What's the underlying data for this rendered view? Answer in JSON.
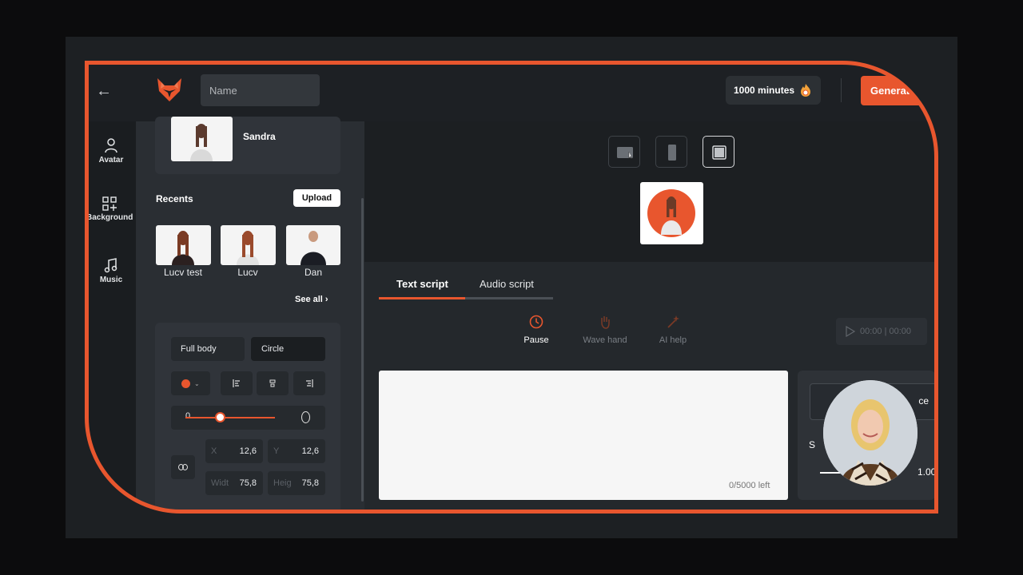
{
  "header": {
    "name_placeholder": "Name",
    "minutes_label": "1000 minutes",
    "generate_label": "Generate"
  },
  "rail": {
    "items": [
      {
        "label": "Avatar",
        "icon": "user-icon"
      },
      {
        "label": "Background",
        "icon": "grid-plus-icon"
      },
      {
        "label": "Music",
        "icon": "music-note-icon"
      }
    ]
  },
  "panel": {
    "selected_avatar": "Sandra",
    "recents_label": "Recents",
    "upload_label": "Upload",
    "recents": [
      {
        "label": "Lucv   test"
      },
      {
        "label": "Lucv"
      },
      {
        "label": "Dan"
      }
    ],
    "see_all_label": "See all",
    "shape_options": [
      "Full body",
      "Circle"
    ],
    "active_shape": "Circle",
    "accent_color": "#e8562e",
    "slider_min_label": "0",
    "x_label": "X",
    "x_value": "12,6",
    "y_label": "Y",
    "y_value": "12,6",
    "width_label": "Widt",
    "width_value": "75,8",
    "height_label": "Heig",
    "height_value": "75,8"
  },
  "script": {
    "tabs": [
      "Text script",
      "Audio script"
    ],
    "active_tab": "Text script",
    "tools": [
      {
        "label": "Pause",
        "icon": "clock-icon",
        "enabled": true
      },
      {
        "label": "Wave hand",
        "icon": "hand-icon",
        "enabled": false
      },
      {
        "label": "AI help",
        "icon": "magic-wand-icon",
        "enabled": false
      }
    ],
    "timer": "00:00 | 00:00",
    "counter": "0/5000 left"
  },
  "voice": {
    "select_text": "ce",
    "setting_label": "S",
    "setting_value": "1.00"
  },
  "colors": {
    "accent": "#e8562e",
    "frame_border": "#e8562e",
    "background": "#1e2226"
  }
}
